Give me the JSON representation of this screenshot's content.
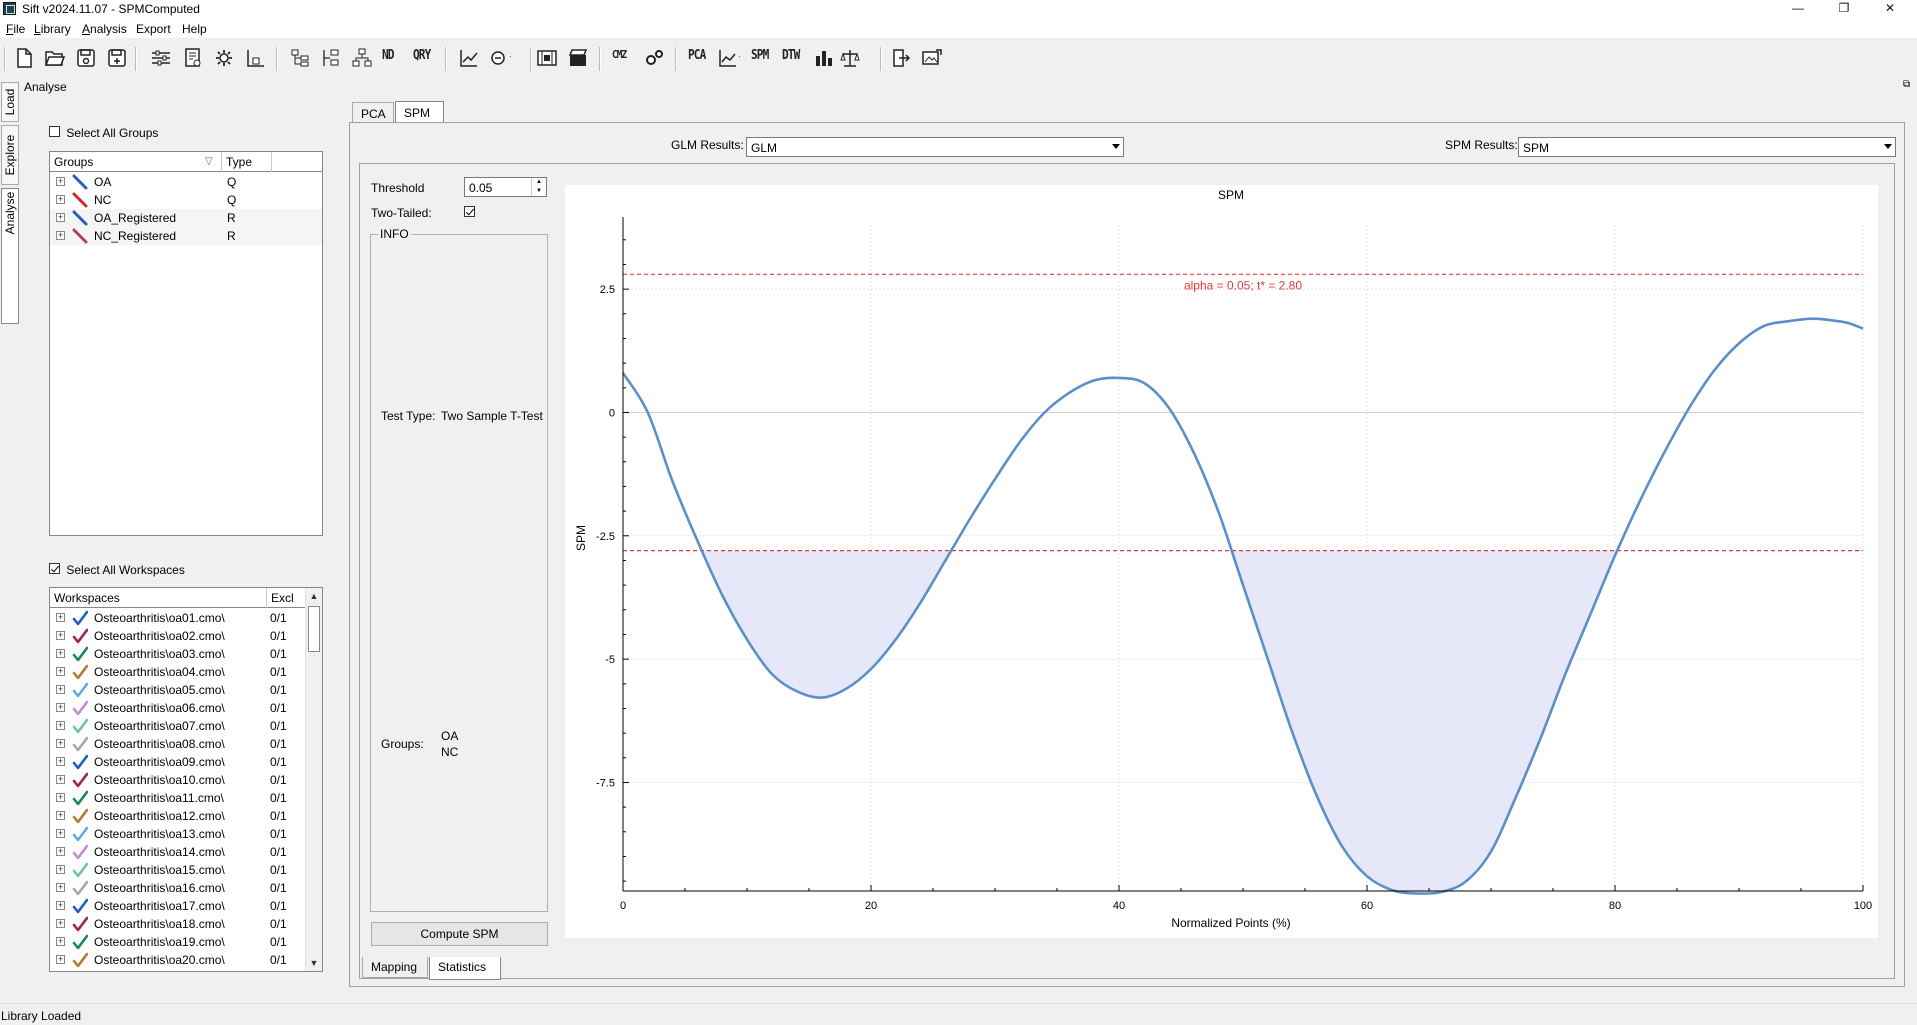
{
  "window": {
    "title": "Sift v2024.11.07 - SPMComputed",
    "controls": [
      "—",
      "❐",
      "✕"
    ]
  },
  "menu": [
    {
      "label": "File",
      "u": "F",
      "rest": "ile"
    },
    {
      "label": "Library",
      "u": "L",
      "rest": "ibrary"
    },
    {
      "label": "Analysis",
      "u": "A",
      "rest": "nalysis"
    },
    {
      "label": "Export",
      "u": "",
      "rest": "Export"
    },
    {
      "label": "Help",
      "u": "",
      "rest": "Help"
    }
  ],
  "toolbar": {
    "text_buttons": [
      "ND",
      "QRY",
      "CMZ",
      "PCA",
      "SPM",
      "DTW"
    ]
  },
  "side_tabs": [
    "Load",
    "Explore",
    "Analyse"
  ],
  "panel_title": "Analyse",
  "groups_panel": {
    "select_all_label": "Select All Groups",
    "select_all_checked": false,
    "columns": [
      "Groups",
      "Type"
    ],
    "rows": [
      {
        "name": "OA",
        "type": "Q",
        "color": "#1f5fbf"
      },
      {
        "name": "NC",
        "type": "Q",
        "color": "#d62728"
      },
      {
        "name": "OA_Registered",
        "type": "R",
        "color": "#1f5fbf"
      },
      {
        "name": "NC_Registered",
        "type": "R",
        "color": "#b04060"
      }
    ]
  },
  "workspaces_panel": {
    "select_all_label": "Select All Workspaces",
    "select_all_checked": true,
    "columns": [
      "Workspaces",
      "Excl"
    ],
    "rows": [
      {
        "name": "Osteoarthritis\\oa01.cmo\\",
        "excl": "0/1",
        "color": "#1f5fbf"
      },
      {
        "name": "Osteoarthritis\\oa02.cmo\\",
        "excl": "0/1",
        "color": "#a0205a"
      },
      {
        "name": "Osteoarthritis\\oa03.cmo\\",
        "excl": "0/1",
        "color": "#1a8a4a"
      },
      {
        "name": "Osteoarthritis\\oa04.cmo\\",
        "excl": "0/1",
        "color": "#b87a30"
      },
      {
        "name": "Osteoarthritis\\oa05.cmo\\",
        "excl": "0/1",
        "color": "#6aa8e0"
      },
      {
        "name": "Osteoarthritis\\oa06.cmo\\",
        "excl": "0/1",
        "color": "#c090c8"
      },
      {
        "name": "Osteoarthritis\\oa07.cmo\\",
        "excl": "0/1",
        "color": "#70c0b0"
      },
      {
        "name": "Osteoarthritis\\oa08.cmo\\",
        "excl": "0/1",
        "color": "#a8a8a8"
      },
      {
        "name": "Osteoarthritis\\oa09.cmo\\",
        "excl": "0/1",
        "color": "#1f5fbf"
      },
      {
        "name": "Osteoarthritis\\oa10.cmo\\",
        "excl": "0/1",
        "color": "#a0205a"
      },
      {
        "name": "Osteoarthritis\\oa11.cmo\\",
        "excl": "0/1",
        "color": "#1a8a4a"
      },
      {
        "name": "Osteoarthritis\\oa12.cmo\\",
        "excl": "0/1",
        "color": "#b87a30"
      },
      {
        "name": "Osteoarthritis\\oa13.cmo\\",
        "excl": "0/1",
        "color": "#6aa8e0"
      },
      {
        "name": "Osteoarthritis\\oa14.cmo\\",
        "excl": "0/1",
        "color": "#c090c8"
      },
      {
        "name": "Osteoarthritis\\oa15.cmo\\",
        "excl": "0/1",
        "color": "#70c0b0"
      },
      {
        "name": "Osteoarthritis\\oa16.cmo\\",
        "excl": "0/1",
        "color": "#a8a8a8"
      },
      {
        "name": "Osteoarthritis\\oa17.cmo\\",
        "excl": "0/1",
        "color": "#1f5fbf"
      },
      {
        "name": "Osteoarthritis\\oa18.cmo\\",
        "excl": "0/1",
        "color": "#a0205a"
      },
      {
        "name": "Osteoarthritis\\oa19.cmo\\",
        "excl": "0/1",
        "color": "#1a8a4a"
      },
      {
        "name": "Osteoarthritis\\oa20.cmo\\",
        "excl": "0/1",
        "color": "#b87a30"
      }
    ]
  },
  "analysis_tabs": [
    "PCA",
    "SPM"
  ],
  "active_analysis_tab": "SPM",
  "glm_results": {
    "label": "GLM Results:",
    "value": "GLM"
  },
  "spm_results": {
    "label": "SPM Results:",
    "value": "SPM"
  },
  "threshold": {
    "label": "Threshold",
    "value": "0.05"
  },
  "two_tailed": {
    "label": "Two-Tailed:",
    "checked": true
  },
  "info": {
    "title": "INFO",
    "test_type_label": "Test Type:",
    "test_type_value": "Two Sample T-Test",
    "groups_label": "Groups:",
    "groups_value_1": "OA",
    "groups_value_2": "NC"
  },
  "compute_button": "Compute SPM",
  "bottom_tabs": [
    "Mapping",
    "Statistics"
  ],
  "active_bottom_tab": "Statistics",
  "status": "Library Loaded",
  "chart_data": {
    "type": "line",
    "title": "SPM",
    "xlabel": "Normalized Points (%)",
    "ylabel": "SPM",
    "xlim": [
      0,
      100
    ],
    "ylim": [
      -9.7,
      3.8
    ],
    "xticks": [
      0,
      20,
      40,
      60,
      80,
      100
    ],
    "yticks": [
      2.5,
      0,
      -2.5,
      -5,
      -7.5
    ],
    "ytick_labels": [
      "2.5",
      "0",
      "-2.5",
      "-5",
      "-7.5"
    ],
    "grid": true,
    "threshold": 2.8,
    "threshold_label": "alpha = 0.05; t* = 2.80",
    "colors": {
      "line": "#5b8fc9",
      "threshold": "#e8383d",
      "fill": "#e6e8fa"
    },
    "x": [
      0,
      2,
      4,
      6,
      8,
      10,
      12,
      14,
      16,
      18,
      20,
      22,
      24,
      26,
      28,
      30,
      32,
      34,
      36,
      38,
      40,
      42,
      44,
      46,
      48,
      50,
      52,
      54,
      56,
      58,
      60,
      62,
      64,
      66,
      68,
      70,
      72,
      74,
      76,
      78,
      80,
      82,
      84,
      86,
      88,
      90,
      92,
      94,
      96,
      98,
      99,
      100
    ],
    "y": [
      0.8,
      0.0,
      -1.4,
      -2.6,
      -3.7,
      -4.6,
      -5.3,
      -5.65,
      -5.78,
      -5.6,
      -5.2,
      -4.6,
      -3.85,
      -3.0,
      -2.15,
      -1.35,
      -0.6,
      0.0,
      0.4,
      0.65,
      0.7,
      0.6,
      0.1,
      -0.8,
      -2.0,
      -3.5,
      -5.0,
      -6.5,
      -7.8,
      -8.8,
      -9.4,
      -9.68,
      -9.75,
      -9.72,
      -9.5,
      -8.9,
      -7.8,
      -6.6,
      -5.3,
      -4.1,
      -2.9,
      -1.8,
      -0.8,
      0.1,
      0.85,
      1.4,
      1.75,
      1.85,
      1.9,
      1.85,
      1.8,
      1.7
    ]
  }
}
